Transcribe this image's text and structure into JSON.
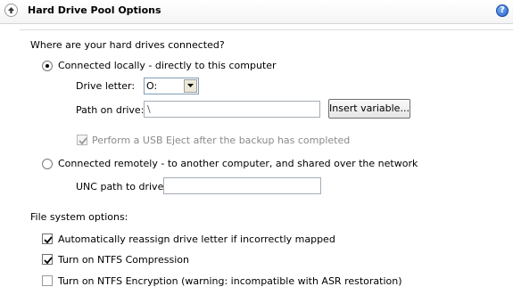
{
  "header": {
    "title": "Hard Drive Pool Options",
    "help_glyph": "?"
  },
  "connection": {
    "question": "Where are your hard drives connected?",
    "local": {
      "label": "Connected locally - directly to this computer",
      "selected": true,
      "drive_letter_label": "Drive letter:",
      "drive_letter_value": "O:",
      "path_label": "Path on drive:",
      "path_value": "\\",
      "insert_variable_label": "Insert variable...",
      "usb_eject_label": "Perform a USB Eject after the backup has completed",
      "usb_eject_checked": true,
      "usb_eject_enabled": false
    },
    "remote": {
      "label": "Connected remotely - to another computer, and shared over the network",
      "selected": false,
      "unc_label": "UNC path to drive:",
      "unc_value": ""
    }
  },
  "filesystem": {
    "heading": "File system options:",
    "options": [
      {
        "label": "Automatically reassign drive letter if incorrectly mapped",
        "checked": true
      },
      {
        "label": "Turn on NTFS Compression",
        "checked": true
      },
      {
        "label": "Turn on NTFS Encryption (warning: incompatible with ASR restoration)",
        "checked": false
      }
    ]
  }
}
